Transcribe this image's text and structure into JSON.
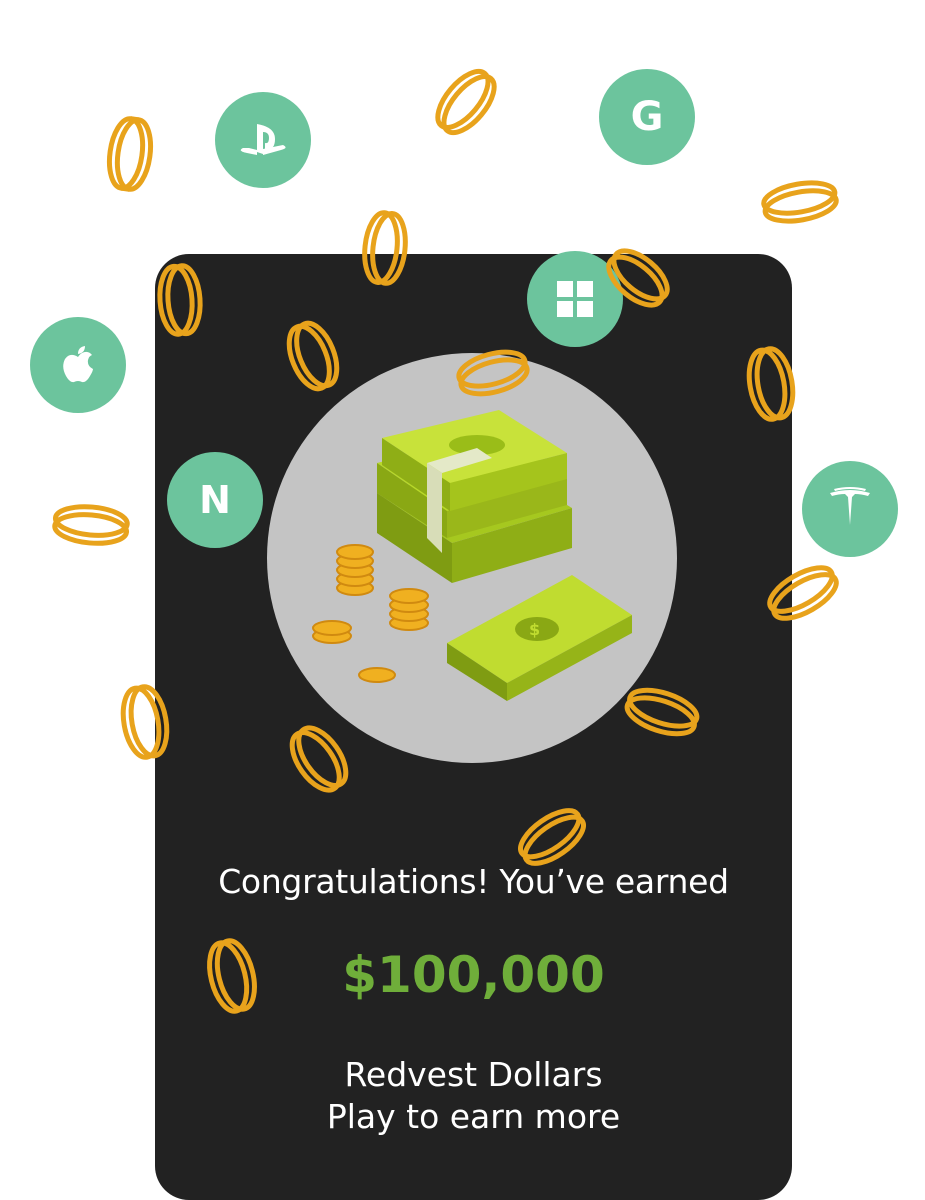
{
  "reward": {
    "headline": "Congratulations! You’ve earned",
    "amount": "$100,000",
    "currency_label": "Redvest Dollars",
    "cta_text": "Play to earn more"
  },
  "brand_icons": [
    {
      "name": "playstation-icon"
    },
    {
      "name": "google-icon",
      "letter": "G"
    },
    {
      "name": "windows-icon"
    },
    {
      "name": "apple-icon"
    },
    {
      "name": "netflix-icon",
      "letter": "N"
    },
    {
      "name": "tesla-icon"
    }
  ],
  "colors": {
    "card_background": "#222222",
    "circle_background": "#c4c4c4",
    "brand_icon_background": "#6cc49d",
    "coin_outline": "#e8a31c",
    "amount": "#6fae3a",
    "text": "#ffffff"
  }
}
